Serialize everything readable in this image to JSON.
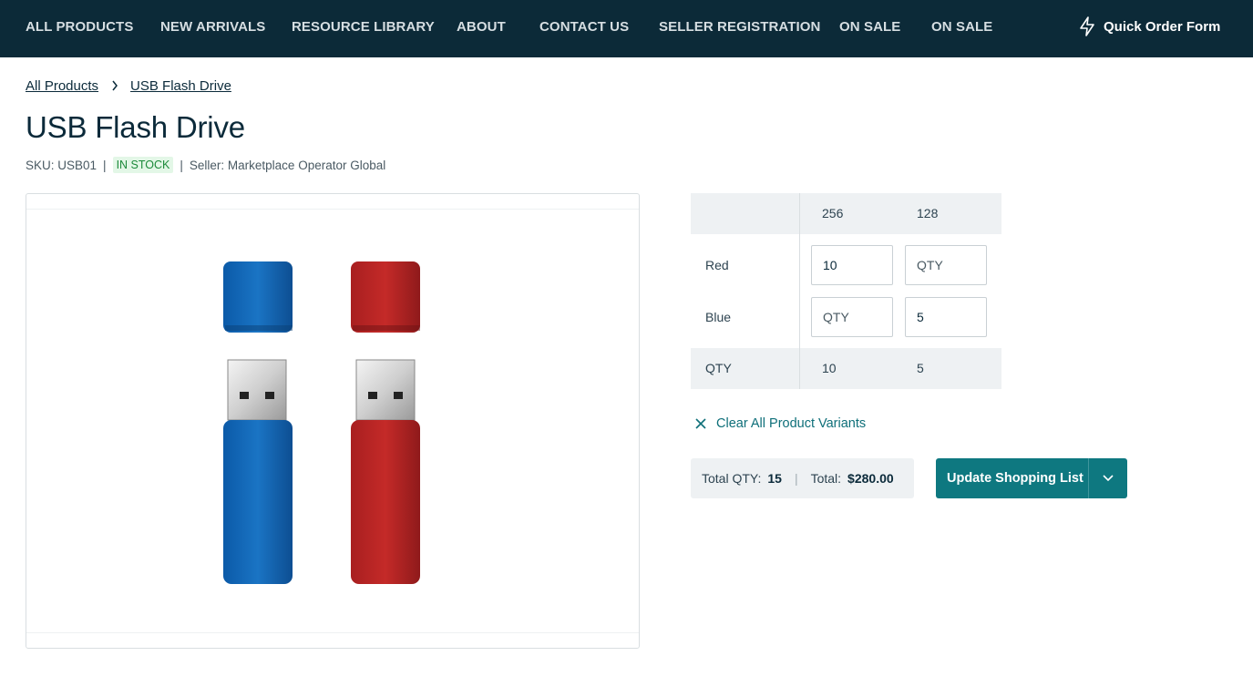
{
  "nav": {
    "items": [
      "ALL PRODUCTS",
      "NEW ARRIVALS",
      "RESOURCE LIBRARY",
      "ABOUT",
      "CONTACT US",
      "SELLER REGISTRATION",
      "ON SALE",
      "ON SALE"
    ],
    "quick_order": {
      "label": "Quick Order Form",
      "icon": "lightning-icon"
    }
  },
  "breadcrumb": [
    "All Products",
    "USB Flash Drive"
  ],
  "product": {
    "title": "USB Flash Drive",
    "sku": "SKU: USB01",
    "stock": "IN STOCK",
    "seller": "Seller: Marketplace Operator Global"
  },
  "matrix": {
    "columns": [
      "256",
      "128"
    ],
    "rows": [
      {
        "label": "Red",
        "values": [
          "10",
          ""
        ]
      },
      {
        "label": "Blue",
        "values": [
          "",
          "5"
        ]
      }
    ],
    "placeholder": "QTY",
    "total_label": "QTY",
    "totals": [
      "10",
      "5"
    ]
  },
  "actions": {
    "clear_label": "Clear All Product Variants",
    "total_qty_label": "Total QTY:",
    "total_qty": "15",
    "total_label": "Total:",
    "total_value": "$280.00",
    "update_label": "Update Shopping List"
  },
  "colors": {
    "nav_bg": "#0c2a38",
    "accent": "#0e7880",
    "stock_bg": "#e3f7e7",
    "stock_text": "#1c8a3a"
  }
}
